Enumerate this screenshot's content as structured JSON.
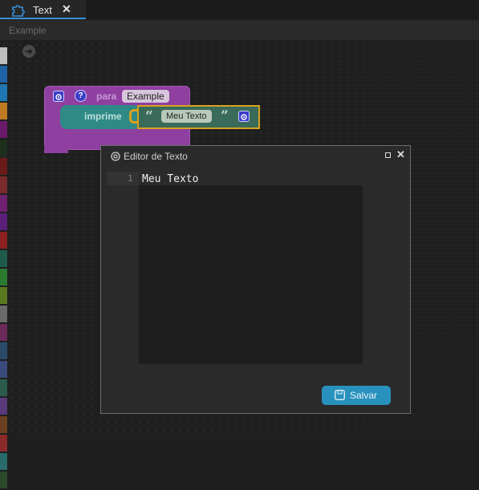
{
  "tab": {
    "title": "Text",
    "close_glyph": "✕",
    "icon": "puzzle-icon"
  },
  "procedure_name_field": {
    "placeholder": "Example"
  },
  "workspace": {
    "nav_glyph": "➜"
  },
  "palette_colors": [
    "#bdbdbd",
    "#1f63a6",
    "#1f77b4",
    "#c07a23",
    "#6b1a6b",
    "#1b2f1b",
    "#6b1a1a",
    "#7a2a2a",
    "#702070",
    "#5b1f7a",
    "#8a2020",
    "#1f5a4a",
    "#2a7a30",
    "#5a7a20",
    "#6a6a6a",
    "#6a2a5a",
    "#2a4a6a",
    "#3a4a7a",
    "#2a5a4a",
    "#5a3a7a",
    "#6a4020",
    "#8a2a2a",
    "#2a6a6a",
    "#2a4a2a"
  ],
  "block": {
    "keyword": "para",
    "procedure_name": "Example",
    "help_glyph": "?",
    "print_label": "imprime",
    "open_quote": "“",
    "close_quote": "”",
    "text_value": "Meu Texto"
  },
  "dialog": {
    "title": "Editor de Texto",
    "line_number": "1",
    "editor_text": "Meu Texto",
    "save_label": "Salvar",
    "close_glyph": "✕"
  },
  "colors": {
    "accent_tab": "#3a8fd6",
    "block_purple": "#8e3fa0",
    "block_teal": "#2f8a86",
    "text_block": "#3a6b5a",
    "highlight_border": "#d8a21f",
    "save_button": "#2991bd",
    "arrow": "#e01b1b"
  }
}
